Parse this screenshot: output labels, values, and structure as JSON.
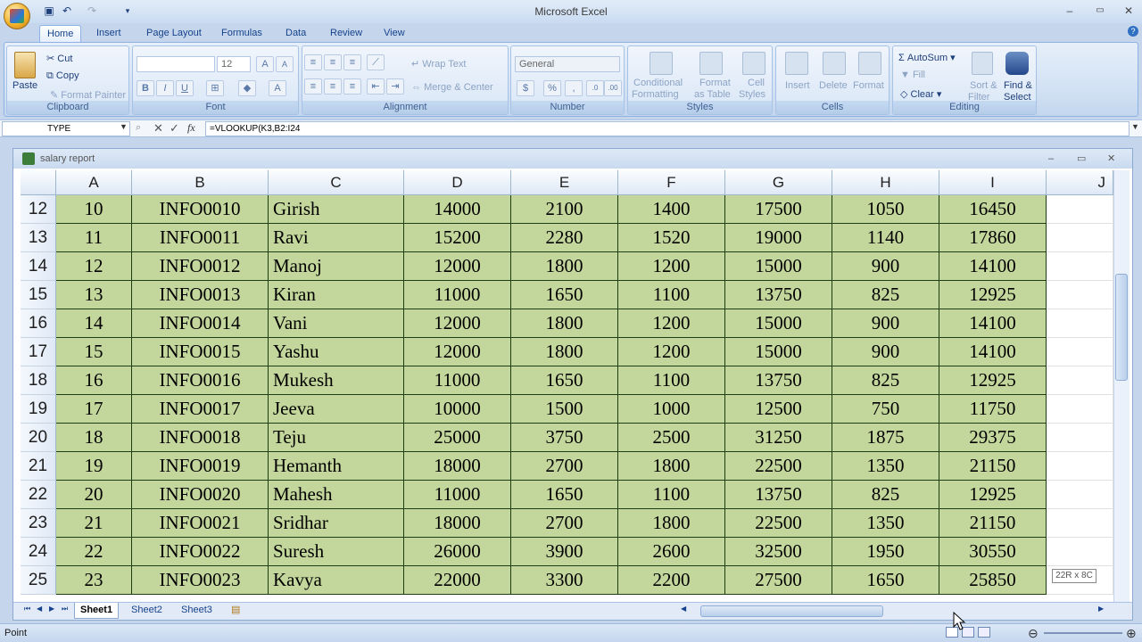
{
  "app_title": "Microsoft Excel",
  "ribbon_tabs": [
    "Home",
    "Insert",
    "Page Layout",
    "Formulas",
    "Data",
    "Review",
    "View"
  ],
  "clipboard": {
    "paste": "Paste",
    "cut": "Cut",
    "copy": "Copy",
    "format_painter": "Format Painter",
    "label": "Clipboard"
  },
  "font": {
    "size": "12",
    "label": "Font"
  },
  "alignment": {
    "wrap": "Wrap Text",
    "merge": "Merge & Center",
    "label": "Alignment"
  },
  "number": {
    "format": "General",
    "label": "Number"
  },
  "styles": {
    "cond1": "Conditional",
    "cond2": "Formatting",
    "fmt1": "Format",
    "fmt2": "as Table",
    "cell1": "Cell",
    "cell2": "Styles",
    "label": "Styles"
  },
  "cells": {
    "insert": "Insert",
    "delete": "Delete",
    "format": "Format",
    "label": "Cells"
  },
  "editing": {
    "autosum": "AutoSum",
    "fill": "Fill",
    "clear": "Clear",
    "sort1": "Sort &",
    "sort2": "Filter",
    "find1": "Find &",
    "find2": "Select",
    "label": "Editing"
  },
  "name_box": "TYPE",
  "formula": "=VLOOKUP(K3,B2:I24",
  "workbook_title": "salary report",
  "columns": [
    "A",
    "B",
    "C",
    "D",
    "E",
    "F",
    "G",
    "H",
    "I",
    "J"
  ],
  "rows": [
    {
      "n": "12",
      "v": [
        "10",
        "INFO0010",
        "Girish",
        "14000",
        "2100",
        "1400",
        "17500",
        "1050",
        "16450"
      ]
    },
    {
      "n": "13",
      "v": [
        "11",
        "INFO0011",
        "Ravi",
        "15200",
        "2280",
        "1520",
        "19000",
        "1140",
        "17860"
      ]
    },
    {
      "n": "14",
      "v": [
        "12",
        "INFO0012",
        "Manoj",
        "12000",
        "1800",
        "1200",
        "15000",
        "900",
        "14100"
      ]
    },
    {
      "n": "15",
      "v": [
        "13",
        "INFO0013",
        "Kiran",
        "11000",
        "1650",
        "1100",
        "13750",
        "825",
        "12925"
      ]
    },
    {
      "n": "16",
      "v": [
        "14",
        "INFO0014",
        "Vani",
        "12000",
        "1800",
        "1200",
        "15000",
        "900",
        "14100"
      ]
    },
    {
      "n": "17",
      "v": [
        "15",
        "INFO0015",
        "Yashu",
        "12000",
        "1800",
        "1200",
        "15000",
        "900",
        "14100"
      ]
    },
    {
      "n": "18",
      "v": [
        "16",
        "INFO0016",
        "Mukesh",
        "11000",
        "1650",
        "1100",
        "13750",
        "825",
        "12925"
      ]
    },
    {
      "n": "19",
      "v": [
        "17",
        "INFO0017",
        "Jeeva",
        "10000",
        "1500",
        "1000",
        "12500",
        "750",
        "11750"
      ]
    },
    {
      "n": "20",
      "v": [
        "18",
        "INFO0018",
        "Teju",
        "25000",
        "3750",
        "2500",
        "31250",
        "1875",
        "29375"
      ]
    },
    {
      "n": "21",
      "v": [
        "19",
        "INFO0019",
        "Hemanth",
        "18000",
        "2700",
        "1800",
        "22500",
        "1350",
        "21150"
      ]
    },
    {
      "n": "22",
      "v": [
        "20",
        "INFO0020",
        "Mahesh",
        "11000",
        "1650",
        "1100",
        "13750",
        "825",
        "12925"
      ]
    },
    {
      "n": "23",
      "v": [
        "21",
        "INFO0021",
        "Sridhar",
        "18000",
        "2700",
        "1800",
        "22500",
        "1350",
        "21150"
      ]
    },
    {
      "n": "24",
      "v": [
        "22",
        "INFO0022",
        "Suresh",
        "26000",
        "3900",
        "2600",
        "32500",
        "1950",
        "30550"
      ]
    },
    {
      "n": "25",
      "v": [
        "23",
        "INFO0023",
        "Kavya",
        "22000",
        "3300",
        "2200",
        "27500",
        "1650",
        "25850"
      ]
    }
  ],
  "sheets": [
    "Sheet1",
    "Sheet2",
    "Sheet3"
  ],
  "selection_tip": "22R x 8C",
  "status": "Point"
}
